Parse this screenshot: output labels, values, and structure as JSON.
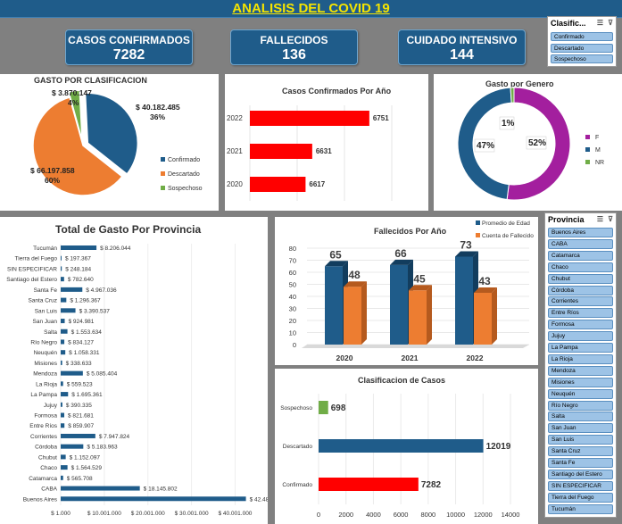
{
  "header": {
    "title": "ANALISIS DEL COVID 19"
  },
  "kpis": [
    {
      "label": "CASOS  CONFIRMADOS",
      "value": "7282"
    },
    {
      "label": "FALLECIDOS",
      "value": "136"
    },
    {
      "label": "CUIDADO INTENSIVO",
      "value": "144"
    }
  ],
  "slicer_clasificacion": {
    "title": "Clasific...",
    "items": [
      "Confirmado",
      "Descartado",
      "Sospechoso"
    ]
  },
  "slicer_provincia": {
    "title": "Provincia",
    "items": [
      "Buenos Aires",
      "CABA",
      "Catamarca",
      "Chaco",
      "Chubut",
      "Córdoba",
      "Corrientes",
      "Entre Ríos",
      "Formosa",
      "Jujuy",
      "La Pampa",
      "La Rioja",
      "Mendoza",
      "Misiones",
      "Neuquén",
      "Río Negro",
      "Salta",
      "San Juan",
      "San Luis",
      "Santa Cruz",
      "Santa Fe",
      "Santiago del Estero",
      "SIN ESPECIFICAR",
      "Tierra del Fuego",
      "Tucumán"
    ]
  },
  "colors": {
    "accent": "#1f5c8a",
    "red": "#ff0000",
    "orange": "#ed7d31",
    "green": "#70ad47",
    "purple": "#a31f9e",
    "slicer": "#9dc3e6",
    "title_yellow": "#f5e400"
  },
  "chart_data": [
    {
      "type": "pie",
      "title": "GASTO POR CLASIFICACION",
      "labels": [
        "Confirmado",
        "Descartado",
        "Sospechoso"
      ],
      "values": [
        40182485,
        66197858,
        3870147
      ],
      "value_labels": [
        "$ 40.182.485",
        "$ 66.197.858",
        "$ 3.870.147"
      ],
      "percent_labels": [
        "36%",
        "60%",
        "4%"
      ],
      "colors": [
        "#1f5c8a",
        "#ed7d31",
        "#70ad47"
      ],
      "legend": "right"
    },
    {
      "type": "bar",
      "orientation": "horizontal",
      "title": "Casos Confirmados Por Año",
      "categories": [
        "2022",
        "2021",
        "2020"
      ],
      "values": [
        6751,
        6631,
        6617
      ],
      "value_labels": [
        "6751",
        "6631",
        "6617"
      ],
      "color": "#ff0000",
      "xlim": [
        6500,
        6800
      ]
    },
    {
      "type": "pie",
      "title": "Gasto por Genero",
      "labels": [
        "F",
        "M",
        "NR"
      ],
      "values": [
        52,
        47,
        1
      ],
      "percent_labels": [
        "52%",
        "47%",
        "1%"
      ],
      "colors": [
        "#a31f9e",
        "#1f5c8a",
        "#70ad47"
      ],
      "legend": "right"
    },
    {
      "type": "bar",
      "orientation": "horizontal",
      "title": "Total de Gasto Por Provincia",
      "categories": [
        "Tucumán",
        "Tierra del Fuego",
        "SIN ESPECIFICAR",
        "Santiago del Estero",
        "Santa Fe",
        "Santa Cruz",
        "San Luis",
        "San Juan",
        "Salta",
        "Río Negro",
        "Neuquén",
        "Misiones",
        "Mendoza",
        "La Rioja",
        "La Pampa",
        "Jujuy",
        "Formosa",
        "Entre Ríos",
        "Corrientes",
        "Córdoba",
        "Chubut",
        "Chaco",
        "Catamarca",
        "CABA",
        "Buenos Aires"
      ],
      "values": [
        8206044,
        197367,
        248184,
        782640,
        4967036,
        1296367,
        3390537,
        924981,
        1553634,
        834127,
        1058331,
        338633,
        5085404,
        559523,
        1695361,
        390335,
        821681,
        859907,
        7947824,
        5183963,
        1152097,
        1564529,
        565708,
        18145802,
        42481085
      ],
      "value_labels": [
        "$ 8.206.044",
        "$ 197.367",
        "$ 248.184",
        "$ 782.640",
        "$ 4.967.036",
        "$ 1.296.367",
        "$ 3.390.537",
        "$ 924.981",
        "$ 1.553.634",
        "$ 834.127",
        "$ 1.058.331",
        "$ 338.633",
        "$ 5.085.404",
        "$ 559.523",
        "$ 1.695.361",
        "$ 390.335",
        "$ 821.681",
        "$ 859.907",
        "$ 7.947.824",
        "$ 5.183.963",
        "$ 1.152.097",
        "$ 1.564.529",
        "$ 565.708",
        "$ 18.145.802",
        "$ 42.481.085"
      ],
      "tick_labels": [
        "$ 1.000",
        "$ 10.001.000",
        "$ 20.001.000",
        "$ 30.001.000",
        "$ 40.001.000"
      ],
      "color": "#1f5c8a",
      "xlim": [
        1000,
        44000000
      ]
    },
    {
      "type": "bar",
      "title": "Fallecidos Por Año",
      "categories": [
        "2020",
        "2021",
        "2022"
      ],
      "series": [
        {
          "name": "Promedio de Edad",
          "values": [
            65,
            66,
            73
          ],
          "color": "#1f5c8a"
        },
        {
          "name": "Cuenta de Fallecido",
          "values": [
            48,
            45,
            43
          ],
          "color": "#ed7d31"
        }
      ],
      "ylim": [
        0,
        80
      ],
      "yticks": [
        "0",
        "10",
        "20",
        "30",
        "40",
        "50",
        "60",
        "70",
        "80"
      ],
      "legend": "top-right"
    },
    {
      "type": "bar",
      "orientation": "horizontal",
      "title": "Clasificacion de Casos",
      "categories": [
        "Sospechoso",
        "Descartado",
        "Confirmado"
      ],
      "values": [
        698,
        12019,
        7282
      ],
      "value_labels": [
        "698",
        "12019",
        "7282"
      ],
      "colors": [
        "#70ad47",
        "#1f5c8a",
        "#ff0000"
      ],
      "xlim": [
        0,
        14000
      ],
      "xticks": [
        "0",
        "2000",
        "4000",
        "6000",
        "8000",
        "10000",
        "12000",
        "14000"
      ]
    }
  ]
}
